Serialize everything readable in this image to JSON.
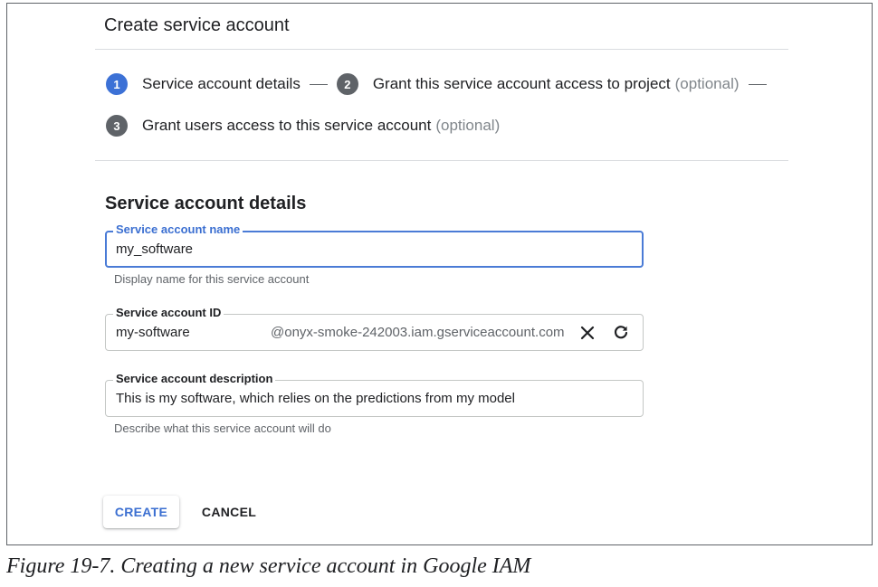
{
  "page": {
    "title": "Create service account",
    "section_title": "Service account details"
  },
  "stepper": {
    "steps": [
      {
        "number": "1",
        "label": "Service account details",
        "optional": "",
        "state": "active"
      },
      {
        "number": "2",
        "label": "Grant this service account access to project",
        "optional": "(optional)",
        "state": "inactive"
      },
      {
        "number": "3",
        "label": "Grant users access to this service account",
        "optional": "(optional)",
        "state": "inactive"
      }
    ],
    "separator": "—"
  },
  "form": {
    "name": {
      "label": "Service account name",
      "value": "my_software",
      "helper": "Display name for this service account"
    },
    "id": {
      "label": "Service account ID",
      "value": "my-software",
      "suffix": "@onyx-smoke-242003.iam.gserviceaccount.com",
      "clear_icon": "close-icon",
      "refresh_icon": "refresh-icon"
    },
    "description": {
      "label": "Service account description",
      "value": "This is my software, which relies on the predictions from my model",
      "helper": "Describe what this service account will do"
    }
  },
  "actions": {
    "create_label": "CREATE",
    "cancel_label": "CANCEL"
  },
  "caption": "Figure 19-7. Creating a new service account in Google IAM",
  "colors": {
    "accent": "#3b6fd1",
    "active_step": "#3c71d6",
    "inactive_step": "#5f6368",
    "helper_text": "#5f6368",
    "optional_text": "#80868b"
  }
}
